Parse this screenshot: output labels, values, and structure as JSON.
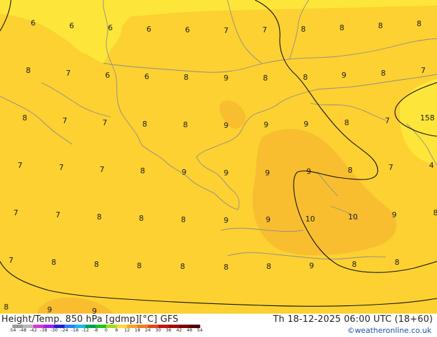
{
  "map": {
    "isotherm_labels": [
      [
        "6",
        48,
        37
      ],
      [
        "6",
        104,
        41
      ],
      [
        "6",
        160,
        44
      ],
      [
        "6",
        216,
        46
      ],
      [
        "6",
        272,
        47
      ],
      [
        "7",
        328,
        48
      ],
      [
        "7",
        384,
        47
      ],
      [
        "8",
        440,
        46
      ],
      [
        "8",
        496,
        44
      ],
      [
        "8",
        552,
        41
      ],
      [
        "8",
        608,
        38
      ],
      [
        "8",
        41,
        106
      ],
      [
        "7",
        99,
        110
      ],
      [
        "6",
        156,
        113
      ],
      [
        "6",
        213,
        115
      ],
      [
        "8",
        270,
        116
      ],
      [
        "9",
        328,
        117
      ],
      [
        "8",
        385,
        117
      ],
      [
        "8",
        443,
        116
      ],
      [
        "9",
        499,
        113
      ],
      [
        "8",
        556,
        110
      ],
      [
        "7",
        614,
        106
      ],
      [
        "8",
        36,
        175
      ],
      [
        "7",
        94,
        179
      ],
      [
        "7",
        152,
        182
      ],
      [
        "8",
        210,
        184
      ],
      [
        "8",
        269,
        185
      ],
      [
        "9",
        328,
        186
      ],
      [
        "9",
        386,
        185
      ],
      [
        "9",
        444,
        184
      ],
      [
        "8",
        503,
        182
      ],
      [
        "7",
        562,
        179
      ],
      [
        "158",
        620,
        175
      ],
      [
        "7",
        29,
        244
      ],
      [
        "7",
        89,
        247
      ],
      [
        "7",
        148,
        250
      ],
      [
        "8",
        207,
        252
      ],
      [
        "9",
        267,
        254
      ],
      [
        "9",
        328,
        255
      ],
      [
        "9",
        388,
        255
      ],
      [
        "9",
        448,
        253
      ],
      [
        "8",
        508,
        251
      ],
      [
        "7",
        567,
        247
      ],
      [
        "4",
        626,
        244
      ],
      [
        "7",
        23,
        313
      ],
      [
        "7",
        84,
        316
      ],
      [
        "8",
        144,
        319
      ],
      [
        "8",
        205,
        321
      ],
      [
        "8",
        266,
        323
      ],
      [
        "9",
        328,
        324
      ],
      [
        "9",
        389,
        323
      ],
      [
        "10",
        450,
        322
      ],
      [
        "10",
        512,
        319
      ],
      [
        "9",
        572,
        316
      ],
      [
        "8",
        632,
        313
      ],
      [
        "7",
        16,
        382
      ],
      [
        "8",
        78,
        385
      ],
      [
        "8",
        140,
        388
      ],
      [
        "8",
        202,
        390
      ],
      [
        "8",
        265,
        391
      ],
      [
        "8",
        328,
        392
      ],
      [
        "8",
        390,
        391
      ],
      [
        "9",
        452,
        390
      ],
      [
        "8",
        514,
        388
      ],
      [
        "8",
        576,
        385
      ],
      [
        "8",
        9,
        450
      ],
      [
        "9",
        72,
        454
      ],
      [
        "9",
        137,
        456
      ]
    ]
  },
  "footer": {
    "title": "Height/Temp. 850 hPa [gdmp][°C] GFS",
    "datetime": "Th 18-12-2025 06:00 UTC (18+60)",
    "credit": "©weatheronline.co.uk",
    "colorbar_ticks": [
      "-54",
      "-48",
      "-42",
      "-38",
      "-30",
      "-24",
      "-18",
      "-12",
      "-8",
      "0",
      "8",
      "12",
      "18",
      "24",
      "30",
      "36",
      "42",
      "48",
      "54"
    ],
    "colorbar_colors": [
      "#9a9a9a",
      "#b8b8b8",
      "#d33bd3",
      "#a020f0",
      "#2020d0",
      "#2a7cff",
      "#19b7f0",
      "#00a050",
      "#20c020",
      "#9be01a",
      "#ffd83a",
      "#f5a623",
      "#f07c1a",
      "#e04a1a",
      "#c81414",
      "#a30a0a",
      "#7d0000",
      "#500000"
    ],
    "colors": {
      "field_main": "#fcd131",
      "field_light": "#fde53a",
      "field_warm": "#f8be30",
      "coast": "#8d8d8d",
      "isohypse": "#111111"
    }
  }
}
